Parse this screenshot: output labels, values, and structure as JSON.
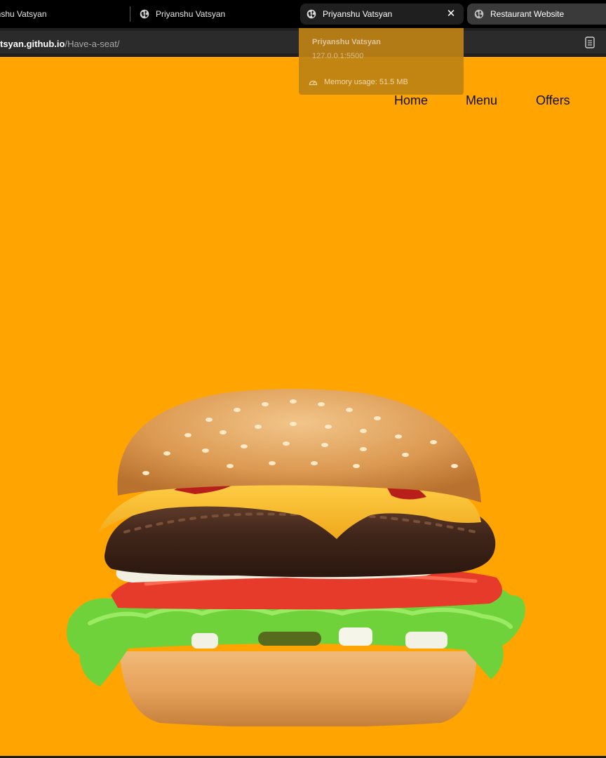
{
  "browser": {
    "tabs": [
      {
        "title": "anshu Vatsyan",
        "active": false
      },
      {
        "title": "Priyanshu Vatsyan",
        "active": false
      },
      {
        "title": "Priyanshu Vatsyan",
        "active": true
      },
      {
        "title": "Restaurant Website",
        "active": false
      }
    ],
    "address": {
      "host": "tsyan.github.io",
      "path": "/Have-a-seat/"
    },
    "hover_card": {
      "title": "Priyanshu Vatsyan",
      "url": "127.0.0.1:5500",
      "memory": "Memory usage: 51.5 MB"
    }
  },
  "page": {
    "background": "#ffa400",
    "nav": [
      "Home",
      "Menu",
      "Offers"
    ],
    "hero_image": "burger"
  }
}
